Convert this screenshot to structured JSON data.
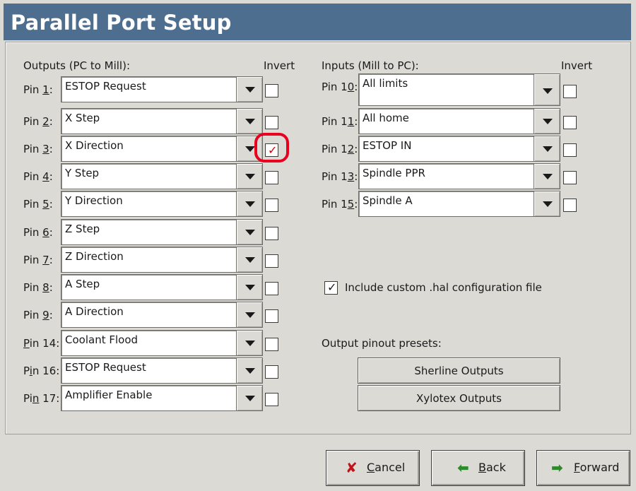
{
  "window": {
    "title": "Parallel Port Setup"
  },
  "outputs": {
    "header": "Outputs (PC to Mill):",
    "invert_header": "Invert",
    "pins": [
      {
        "label_pre": "Pin ",
        "label_ul": "1",
        "label_post": ":",
        "value": "ESTOP Request",
        "invert": false
      },
      {
        "label_pre": "Pin ",
        "label_ul": "2",
        "label_post": ":",
        "value": "X Step",
        "invert": false
      },
      {
        "label_pre": "Pin ",
        "label_ul": "3",
        "label_post": ":",
        "value": "X Direction",
        "invert": true
      },
      {
        "label_pre": "Pin ",
        "label_ul": "4",
        "label_post": ":",
        "value": "Y Step",
        "invert": false
      },
      {
        "label_pre": "Pin ",
        "label_ul": "5",
        "label_post": ":",
        "value": "Y Direction",
        "invert": false
      },
      {
        "label_pre": "Pin ",
        "label_ul": "6",
        "label_post": ":",
        "value": "Z Step",
        "invert": false
      },
      {
        "label_pre": "Pin ",
        "label_ul": "7",
        "label_post": ":",
        "value": "Z Direction",
        "invert": false
      },
      {
        "label_pre": "Pin ",
        "label_ul": "8",
        "label_post": ":",
        "value": "A Step",
        "invert": false
      },
      {
        "label_pre": "Pin ",
        "label_ul": "9",
        "label_post": ":",
        "value": "A Direction",
        "invert": false
      },
      {
        "label_pre": "",
        "label_ul": "P",
        "label_post": "in 14:",
        "value": "Coolant Flood",
        "invert": false
      },
      {
        "label_pre": "P",
        "label_ul": "i",
        "label_post": "n 16:",
        "value": "ESTOP Request",
        "invert": false
      },
      {
        "label_pre": "Pi",
        "label_ul": "n",
        "label_post": " 17:",
        "value": "Amplifier Enable",
        "invert": false
      }
    ]
  },
  "inputs": {
    "header": "Inputs (Mill to PC):",
    "invert_header": "Invert",
    "pins": [
      {
        "label_pre": "Pin 1",
        "label_ul": "0",
        "label_post": ":",
        "value": "All limits",
        "invert": false
      },
      {
        "label_pre": "Pin 1",
        "label_ul": "1",
        "label_post": ":",
        "value": "All home",
        "invert": false
      },
      {
        "label_pre": "Pin 1",
        "label_ul": "2",
        "label_post": ":",
        "value": "ESTOP IN",
        "invert": false
      },
      {
        "label_pre": "Pin 1",
        "label_ul": "3",
        "label_post": ":",
        "value": "Spindle PPR",
        "invert": false
      },
      {
        "label_pre": "Pin 1",
        "label_ul": "5",
        "label_post": ":",
        "value": "Spindle A",
        "invert": false
      }
    ]
  },
  "custom_hal": {
    "label": "Include custom .hal configuration file",
    "checked": true
  },
  "presets": {
    "header": "Output pinout presets:",
    "sherline": "Sherline Outputs",
    "xylotex": "Xylotex Outputs"
  },
  "footer": {
    "cancel_ul": "C",
    "cancel_rest": "ancel",
    "back_ul": "B",
    "back_rest": "ack",
    "forward_ul": "F",
    "forward_rest": "orward"
  },
  "icons": {
    "combo_arrow": "chevron-down-icon",
    "cancel": "x-icon",
    "back": "arrow-left-icon",
    "forward": "arrow-right-icon",
    "checkmark": "checkmark-icon"
  },
  "colors": {
    "titlebar": "#4d6e8f",
    "annotation": "#e8001e",
    "checkmark_highlight": "#d40000"
  }
}
